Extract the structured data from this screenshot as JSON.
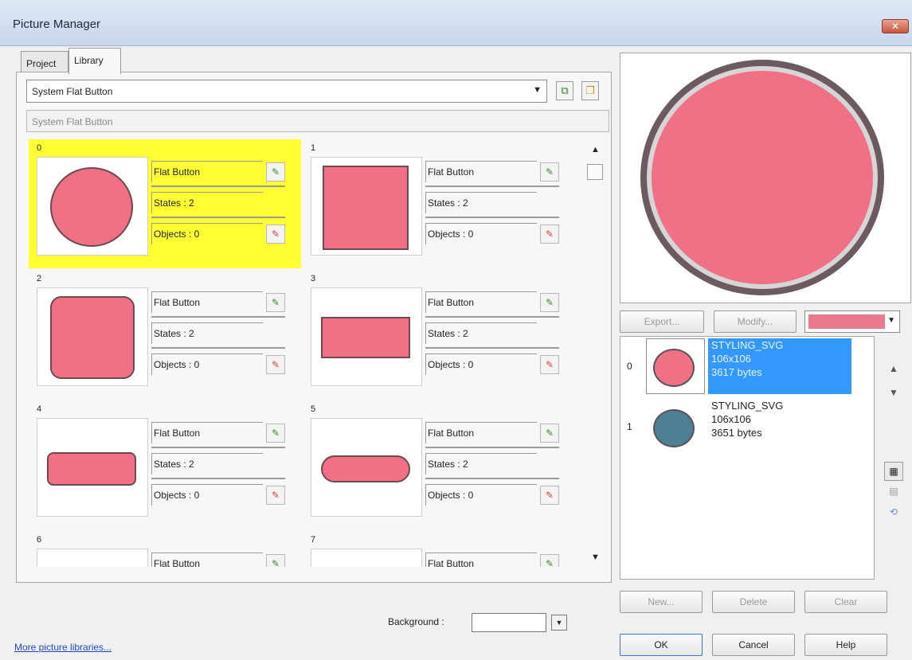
{
  "window": {
    "title": "Picture Manager",
    "close_label": "✕"
  },
  "tabs": [
    {
      "label": "Project"
    },
    {
      "label": "Library"
    }
  ],
  "library": {
    "selected": "System Flat Button",
    "name_display": "System Flat Button"
  },
  "cells": [
    {
      "index": "0",
      "name": "Flat Button",
      "states": "States : 2",
      "objects": "Objects : 0"
    },
    {
      "index": "1",
      "name": "Flat Button",
      "states": "States : 2",
      "objects": "Objects : 0"
    },
    {
      "index": "2",
      "name": "Flat Button",
      "states": "States : 2",
      "objects": "Objects : 0"
    },
    {
      "index": "3",
      "name": "Flat Button",
      "states": "States : 2",
      "objects": "Objects : 0"
    },
    {
      "index": "4",
      "name": "Flat Button",
      "states": "States : 2",
      "objects": "Objects : 0"
    },
    {
      "index": "5",
      "name": "Flat Button",
      "states": "States : 2",
      "objects": "Objects : 0"
    },
    {
      "index": "6",
      "name": "Flat Button"
    },
    {
      "index": "7",
      "name": "Flat Button"
    }
  ],
  "background_label": "Background :",
  "more_link": "More picture libraries...",
  "preview_buttons": {
    "export": "Export...",
    "modify": "Modify..."
  },
  "color_swatch": "#e87a8b",
  "states": [
    {
      "index": "0",
      "type": "STYLING_SVG",
      "size": "106x106",
      "bytes": "3617 bytes",
      "color": "#f07186"
    },
    {
      "index": "1",
      "type": "STYLING_SVG",
      "size": "106x106",
      "bytes": "3651 bytes",
      "color": "#4e7f94"
    }
  ],
  "state_buttons": {
    "new": "New...",
    "delete": "Delete",
    "clear": "Clear"
  },
  "dialog_buttons": {
    "ok": "OK",
    "cancel": "Cancel",
    "help": "Help"
  },
  "icons": {
    "up": "▲",
    "down": "▼",
    "edit": "✎",
    "combo_arrow": "▼",
    "copy": "⧉",
    "paste": "❐",
    "scroll_up": "▲",
    "scroll_down": "▼",
    "tool_a": "▦",
    "tool_b": "▤",
    "tool_c": "⟲"
  }
}
